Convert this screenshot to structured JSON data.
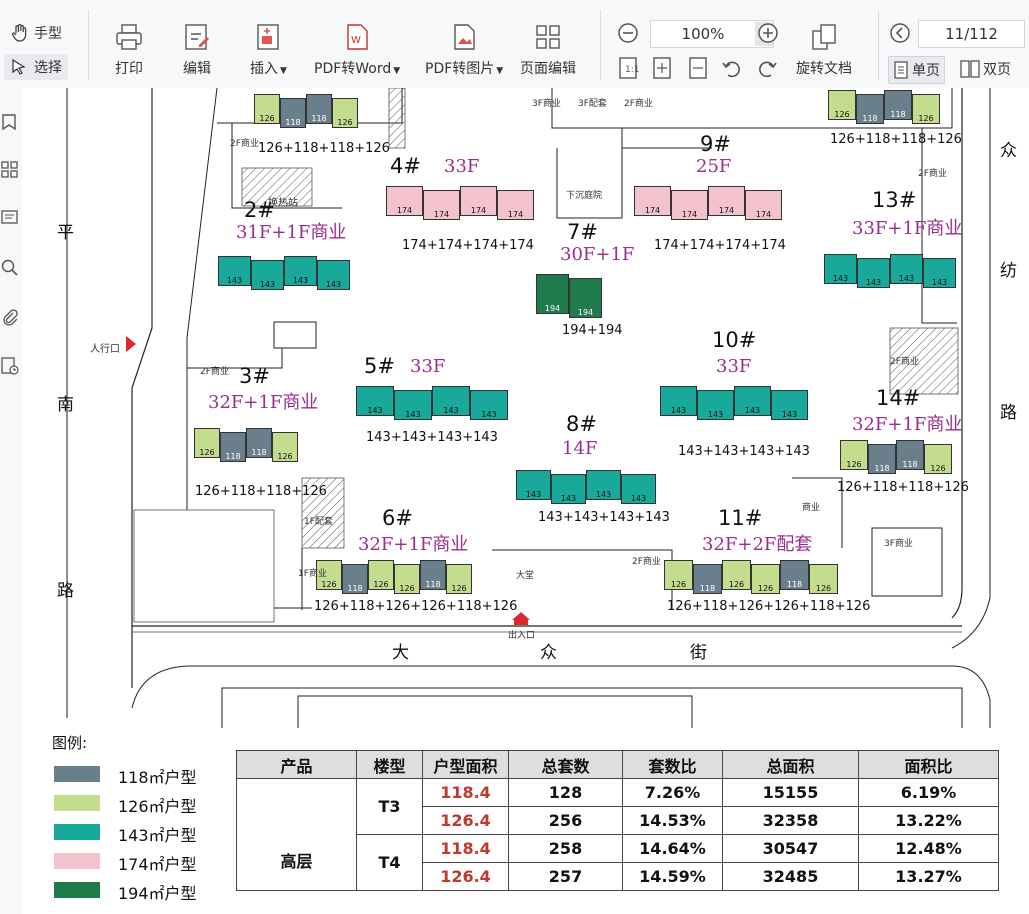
{
  "toolbar": {
    "modes": {
      "hand": "手型",
      "select": "选择"
    },
    "buttons": {
      "print": "打印",
      "edit": "编辑",
      "insert": "插入",
      "pdf_to_word": "PDF转Word",
      "pdf_to_image": "PDF转图片",
      "page_edit": "页面编辑",
      "rotate_doc": "旋转文档"
    },
    "zoom": "100%",
    "page": "11/112",
    "view": {
      "single": "单页",
      "double": "双页"
    }
  },
  "plan": {
    "roads": {
      "left": [
        "平",
        "南",
        "路"
      ],
      "right": [
        "众",
        "纺",
        "路"
      ],
      "bottom": [
        "大",
        "众",
        "街"
      ]
    },
    "buildings": [
      {
        "id": "b1",
        "num": "",
        "floors": "",
        "mix": "126+118+118+126"
      },
      {
        "id": "b2",
        "num": "2#",
        "floors": "31F+1F商业",
        "mix": ""
      },
      {
        "id": "b3",
        "num": "3#",
        "floors": "32F+1F商业",
        "mix": "126+118+118+126"
      },
      {
        "id": "b4",
        "num": "4#",
        "floors": "33F",
        "mix": "174+174+174+174"
      },
      {
        "id": "b5",
        "num": "5#",
        "floors": "33F",
        "mix": "143+143+143+143"
      },
      {
        "id": "b6",
        "num": "6#",
        "floors": "32F+1F商业",
        "mix": "126+118+126+126+118+126"
      },
      {
        "id": "b7",
        "num": "7#",
        "floors": "30F+1F",
        "mix": "194+194"
      },
      {
        "id": "b8",
        "num": "8#",
        "floors": "14F",
        "mix": "143+143+143+143"
      },
      {
        "id": "b9",
        "num": "9#",
        "floors": "25F",
        "mix": "174+174+174+174"
      },
      {
        "id": "b10",
        "num": "10#",
        "floors": "33F",
        "mix": "143+143+143+143"
      },
      {
        "id": "b11",
        "num": "11#",
        "floors": "32F+2F配套",
        "mix": "126+118+126+126+118+126"
      },
      {
        "id": "b12",
        "num": "",
        "floors": "",
        "mix": "126+118+118+126"
      },
      {
        "id": "b13",
        "num": "13#",
        "floors": "33F+1F商业",
        "mix": ""
      },
      {
        "id": "b14",
        "num": "14#",
        "floors": "32F+1F商业",
        "mix": "126+118+118+126"
      }
    ],
    "labels": {
      "heat_station": "换热站",
      "sunken_garden": "下沉庭院",
      "pedestrian_entrance": "人行口",
      "main_entrance": "出入口",
      "commercial_2f": "2F商业",
      "commercial_3f": "3F商业",
      "support_3f": "3F配套",
      "commercial_1f": "1F商业",
      "support_1f": "1F配套",
      "grand_lobby": "大堂",
      "commercial_short": "商业"
    }
  },
  "legend": {
    "title": "图例:",
    "items": [
      {
        "label": "118㎡户型",
        "color": "#6a7f8c"
      },
      {
        "label": "126㎡户型",
        "color": "#c3dc8e"
      },
      {
        "label": "143㎡户型",
        "color": "#19a99a"
      },
      {
        "label": "174㎡户型",
        "color": "#f2c2cd"
      },
      {
        "label": "194㎡户型",
        "color": "#1f7a4c"
      }
    ]
  },
  "table": {
    "headers": [
      "产品",
      "楼型",
      "户型面积",
      "总套数",
      "套数比",
      "总面积",
      "面积比"
    ],
    "product": "高层",
    "groups": [
      {
        "type": "T3",
        "rows": [
          {
            "area": "118.4",
            "units": "128",
            "unit_ratio": "7.26%",
            "total_area": "15155",
            "area_ratio": "6.19%"
          },
          {
            "area": "126.4",
            "units": "256",
            "unit_ratio": "14.53%",
            "total_area": "32358",
            "area_ratio": "13.22%"
          }
        ]
      },
      {
        "type": "T4",
        "rows": [
          {
            "area": "118.4",
            "units": "258",
            "unit_ratio": "14.64%",
            "total_area": "30547",
            "area_ratio": "12.48%"
          },
          {
            "area": "126.4",
            "units": "257",
            "unit_ratio": "14.59%",
            "total_area": "32485",
            "area_ratio": "13.27%"
          }
        ]
      }
    ]
  }
}
